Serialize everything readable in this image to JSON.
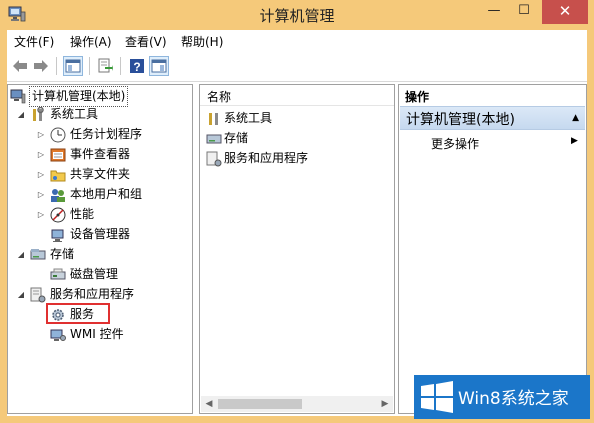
{
  "window": {
    "title": "计算机管理"
  },
  "menu": {
    "file": "文件(F)",
    "action": "操作(A)",
    "view": "查看(V)",
    "help": "帮助(H)"
  },
  "tree": {
    "root": "计算机管理(本地)",
    "system_tools": "系统工具",
    "task_scheduler": "任务计划程序",
    "event_viewer": "事件查看器",
    "shared_folders": "共享文件夹",
    "local_users": "本地用户和组",
    "performance": "性能",
    "device_manager": "设备管理器",
    "storage": "存储",
    "disk_management": "磁盘管理",
    "services_apps": "服务和应用程序",
    "services": "服务",
    "wmi": "WMI 控件"
  },
  "list": {
    "column_name": "名称",
    "items": [
      "系统工具",
      "存储",
      "服务和应用程序"
    ]
  },
  "actions": {
    "header": "操作",
    "section": "计算机管理(本地)",
    "more": "更多操作"
  },
  "watermark": {
    "text": "Win8系统之家"
  },
  "colors": {
    "titlebar": "#f5c97a",
    "close": "#c7504c",
    "highlight": "#e03030",
    "watermark": "#1b76c9"
  }
}
